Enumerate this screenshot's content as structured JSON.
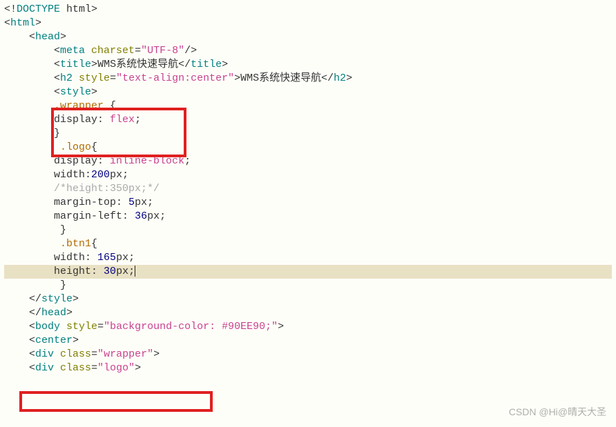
{
  "code": {
    "doctype_open": "<!",
    "doctype": "DOCTYPE",
    "doctype_html": " html",
    "doctype_close": ">",
    "html_open": "<",
    "html": "html",
    "close": ">",
    "head": "head",
    "meta": "meta",
    "charset_attr": " charset",
    "eq": "=",
    "charset_val": "\"UTF-8\"",
    "slashclose": "/>",
    "title": "title",
    "title_text": "WMS系统快速导航",
    "end_open": "</",
    "h2": "h2",
    "style_attr": " style",
    "h2_style_val": "\"text-align:center\"",
    "h2_text": "WMS系统快速导航",
    "style": "style",
    "wrapper_sel": ".wrapper ",
    "lbrace": "{",
    "rbrace": "}",
    "display": "display",
    "colon": ":",
    "colon_sp": ": ",
    "flex": "flex",
    "semi": ";",
    "logo_sel": ".logo",
    "inline_block": "inline-block",
    "width": "width",
    "w200": "200",
    "px": "px",
    "comment": "/*height:350px;*/",
    "margin_top": "margin-top",
    "five": "5",
    "margin_left": "margin-left",
    "thirtysix": "36",
    "btn1_sel": ".btn1",
    "w165": "165",
    "height": "height",
    "h30": "30",
    "body": "body",
    "body_style_val": "\"background-color: #90EE90;\"",
    "center": "center",
    "div": "div",
    "class_attr": " class",
    "wrapper_val": "\"wrapper\"",
    "logo_val": "\"logo\""
  },
  "watermark": "CSDN @Hi@晴天大圣"
}
